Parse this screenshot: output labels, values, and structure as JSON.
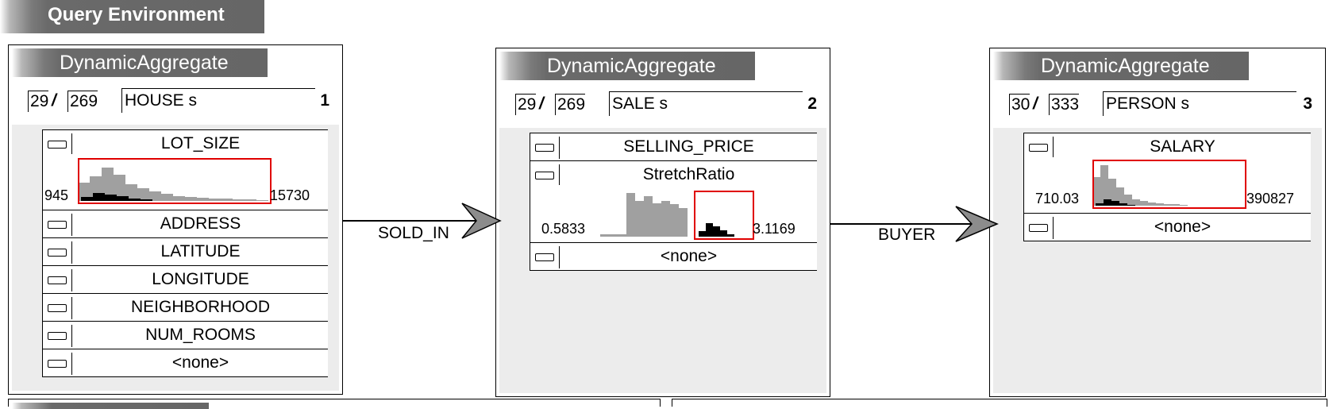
{
  "environment": {
    "title": "Query Environment"
  },
  "colors": {
    "highlight_border": "#e00000",
    "histogram_gray": "#a0a0a0",
    "histogram_selected": "#000000",
    "titlebar": "#666666",
    "panel_bg": "#ececec"
  },
  "panels": [
    {
      "title": "DynamicAggregate",
      "count_selected": "29",
      "count_total": "269",
      "table": "HOUSE s",
      "index": "1",
      "attributes": [
        {
          "label": "LOT_SIZE",
          "histogram": {
            "min": "945",
            "max": "15730",
            "bars": [
              0.42,
              0.58,
              0.78,
              0.62,
              0.38,
              0.3,
              0.22,
              0.16,
              0.12,
              0.1,
              0.08,
              0.06,
              0.05,
              0.04,
              0.03,
              0.02
            ],
            "selected": [
              0.1,
              0.18,
              0.14,
              0.11,
              0.06,
              0.04,
              0.0,
              0.0,
              0.0,
              0.0,
              0.0,
              0.0,
              0.0,
              0.0,
              0.0,
              0.0
            ]
          }
        },
        {
          "label": "ADDRESS"
        },
        {
          "label": "LATITUDE"
        },
        {
          "label": "LONGITUDE"
        },
        {
          "label": "NEIGHBORHOOD"
        },
        {
          "label": "NUM_ROOMS"
        },
        {
          "label": "<none>"
        }
      ]
    },
    {
      "title": "DynamicAggregate",
      "count_selected": "29",
      "count_total": "269",
      "table": "SALE s",
      "index": "2",
      "attributes": [
        {
          "label": "SELLING_PRICE"
        },
        {
          "label": "StretchRatio",
          "histogram": {
            "min": "0.5833",
            "max": "3.1169",
            "bars": [
              0.05,
              0.05,
              0.05,
              0.95,
              0.78,
              0.88,
              0.72,
              0.78,
              0.7,
              0.62,
              0.0,
              0.0,
              0.0,
              0.0,
              0.0
            ],
            "selected": [
              0.0,
              0.0,
              0.0,
              0.0,
              0.0,
              0.0,
              0.0,
              0.0,
              0.0,
              0.0,
              0.12,
              0.3,
              0.22,
              0.14,
              0.06
            ]
          }
        },
        {
          "label": "<none>"
        }
      ]
    },
    {
      "title": "DynamicAggregate",
      "count_selected": "30",
      "count_total": "333",
      "table": "PERSON s",
      "index": "3",
      "attributes": [
        {
          "label": "SALARY",
          "histogram": {
            "min": "710.03",
            "max": "390827",
            "bars": [
              0.62,
              0.88,
              0.58,
              0.4,
              0.24,
              0.14,
              0.1,
              0.07,
              0.05,
              0.04,
              0.03,
              0.02
            ],
            "selected": [
              0.06,
              0.14,
              0.1,
              0.06,
              0.02,
              0.0,
              0.0,
              0.0,
              0.0,
              0.0,
              0.0,
              0.0
            ]
          }
        },
        {
          "label": "<none>"
        }
      ]
    }
  ],
  "relations": [
    {
      "label": "SOLD_IN"
    },
    {
      "label": "BUYER"
    }
  ]
}
